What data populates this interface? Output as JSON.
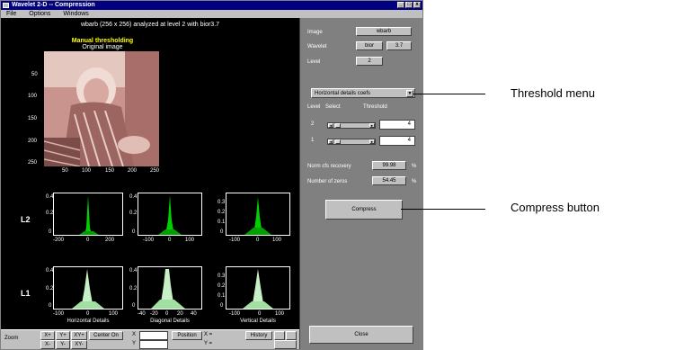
{
  "window": {
    "title": "Wavelet 2-D  --  Compression",
    "min": "_",
    "max": "□",
    "close": "x"
  },
  "menu": [
    "File",
    "Options",
    "Windows"
  ],
  "plot": {
    "subtitle": "wbarb (256 x 256) analyzed at level 2 with bior3.7",
    "image_title": "Manual thresholding",
    "image_subtitle": "Original image",
    "image_yticks": [
      "50",
      "100",
      "150",
      "200",
      "250"
    ],
    "image_xticks": [
      "50",
      "100",
      "150",
      "200",
      "250"
    ],
    "row_labels": [
      "L2",
      "L1"
    ],
    "hist_yticks_a": [
      "0.4",
      "0.2",
      "0"
    ],
    "hist_yticks_b": [
      "0.3",
      "0.2",
      "0.1",
      "0"
    ],
    "l2_xticks": [
      [
        "-200",
        "0",
        "200"
      ],
      [
        "-100",
        "0",
        "100"
      ],
      [
        "-100",
        "0",
        "100"
      ]
    ],
    "l1_xticks": [
      [
        "-100",
        "0",
        "100"
      ],
      [
        "-40",
        "-20",
        "0",
        "20",
        "40"
      ],
      [
        "-100",
        "0",
        "100"
      ]
    ],
    "captions": [
      "Horizontal Details",
      "Diagonal Details",
      "Vertical Details"
    ]
  },
  "panel": {
    "image_label": "Image",
    "image_value": "wbarb",
    "wavelet_label": "Wavelet",
    "wavelet_family": "bior",
    "wavelet_number": "3.7",
    "level_label": "Level",
    "level_value": "2",
    "menu_value": "Horizontal details coefs",
    "col_level": "Level",
    "col_select": "Select",
    "col_threshold": "Threshold",
    "rows": [
      {
        "level": "2",
        "threshold": "4"
      },
      {
        "level": "1",
        "threshold": "4"
      }
    ],
    "norm_label": "Norm cfs recovery",
    "norm_value": "99.98",
    "zeros_label": "Number of zeros",
    "zeros_value": "54.45",
    "percent": "%",
    "compress_label": "Compress",
    "close_label": "Close"
  },
  "bottom": {
    "zoom": "Zoom",
    "xp": "X+",
    "yp": "Y+",
    "xyp": "XY+",
    "xm": "X-",
    "ym": "Y-",
    "xym": "XY-",
    "center_on": "Center On",
    "x": "X",
    "y": "Y",
    "position": "Position",
    "xeq": "X =",
    "yeq": "Y =",
    "history": "History"
  },
  "callouts": {
    "threshold_menu": "Threshold menu",
    "compress_button": "Compress button"
  }
}
